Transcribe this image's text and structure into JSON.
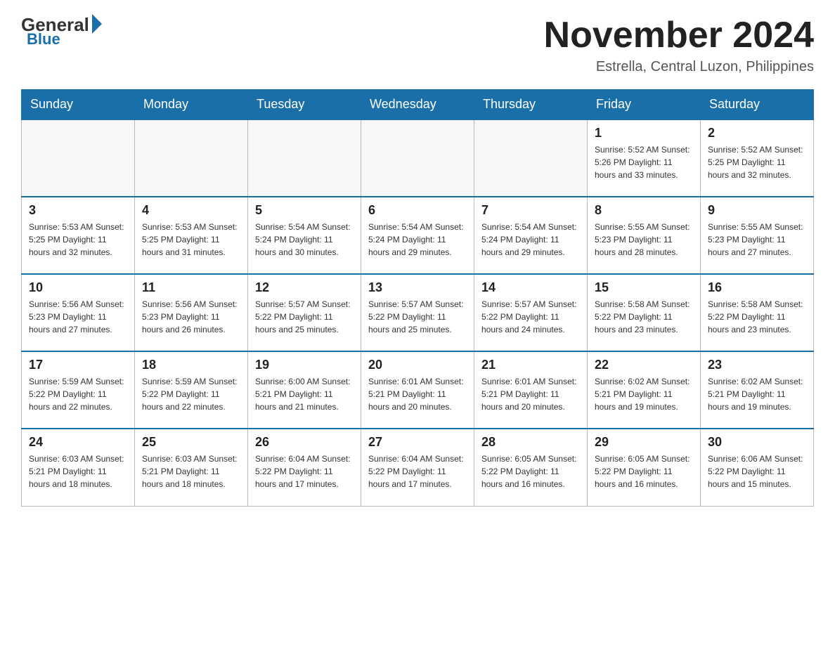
{
  "logo": {
    "general": "General",
    "blue": "Blue"
  },
  "title": "November 2024",
  "location": "Estrella, Central Luzon, Philippines",
  "days_of_week": [
    "Sunday",
    "Monday",
    "Tuesday",
    "Wednesday",
    "Thursday",
    "Friday",
    "Saturday"
  ],
  "weeks": [
    [
      {
        "day": "",
        "info": ""
      },
      {
        "day": "",
        "info": ""
      },
      {
        "day": "",
        "info": ""
      },
      {
        "day": "",
        "info": ""
      },
      {
        "day": "",
        "info": ""
      },
      {
        "day": "1",
        "info": "Sunrise: 5:52 AM\nSunset: 5:26 PM\nDaylight: 11 hours\nand 33 minutes."
      },
      {
        "day": "2",
        "info": "Sunrise: 5:52 AM\nSunset: 5:25 PM\nDaylight: 11 hours\nand 32 minutes."
      }
    ],
    [
      {
        "day": "3",
        "info": "Sunrise: 5:53 AM\nSunset: 5:25 PM\nDaylight: 11 hours\nand 32 minutes."
      },
      {
        "day": "4",
        "info": "Sunrise: 5:53 AM\nSunset: 5:25 PM\nDaylight: 11 hours\nand 31 minutes."
      },
      {
        "day": "5",
        "info": "Sunrise: 5:54 AM\nSunset: 5:24 PM\nDaylight: 11 hours\nand 30 minutes."
      },
      {
        "day": "6",
        "info": "Sunrise: 5:54 AM\nSunset: 5:24 PM\nDaylight: 11 hours\nand 29 minutes."
      },
      {
        "day": "7",
        "info": "Sunrise: 5:54 AM\nSunset: 5:24 PM\nDaylight: 11 hours\nand 29 minutes."
      },
      {
        "day": "8",
        "info": "Sunrise: 5:55 AM\nSunset: 5:23 PM\nDaylight: 11 hours\nand 28 minutes."
      },
      {
        "day": "9",
        "info": "Sunrise: 5:55 AM\nSunset: 5:23 PM\nDaylight: 11 hours\nand 27 minutes."
      }
    ],
    [
      {
        "day": "10",
        "info": "Sunrise: 5:56 AM\nSunset: 5:23 PM\nDaylight: 11 hours\nand 27 minutes."
      },
      {
        "day": "11",
        "info": "Sunrise: 5:56 AM\nSunset: 5:23 PM\nDaylight: 11 hours\nand 26 minutes."
      },
      {
        "day": "12",
        "info": "Sunrise: 5:57 AM\nSunset: 5:22 PM\nDaylight: 11 hours\nand 25 minutes."
      },
      {
        "day": "13",
        "info": "Sunrise: 5:57 AM\nSunset: 5:22 PM\nDaylight: 11 hours\nand 25 minutes."
      },
      {
        "day": "14",
        "info": "Sunrise: 5:57 AM\nSunset: 5:22 PM\nDaylight: 11 hours\nand 24 minutes."
      },
      {
        "day": "15",
        "info": "Sunrise: 5:58 AM\nSunset: 5:22 PM\nDaylight: 11 hours\nand 23 minutes."
      },
      {
        "day": "16",
        "info": "Sunrise: 5:58 AM\nSunset: 5:22 PM\nDaylight: 11 hours\nand 23 minutes."
      }
    ],
    [
      {
        "day": "17",
        "info": "Sunrise: 5:59 AM\nSunset: 5:22 PM\nDaylight: 11 hours\nand 22 minutes."
      },
      {
        "day": "18",
        "info": "Sunrise: 5:59 AM\nSunset: 5:22 PM\nDaylight: 11 hours\nand 22 minutes."
      },
      {
        "day": "19",
        "info": "Sunrise: 6:00 AM\nSunset: 5:21 PM\nDaylight: 11 hours\nand 21 minutes."
      },
      {
        "day": "20",
        "info": "Sunrise: 6:01 AM\nSunset: 5:21 PM\nDaylight: 11 hours\nand 20 minutes."
      },
      {
        "day": "21",
        "info": "Sunrise: 6:01 AM\nSunset: 5:21 PM\nDaylight: 11 hours\nand 20 minutes."
      },
      {
        "day": "22",
        "info": "Sunrise: 6:02 AM\nSunset: 5:21 PM\nDaylight: 11 hours\nand 19 minutes."
      },
      {
        "day": "23",
        "info": "Sunrise: 6:02 AM\nSunset: 5:21 PM\nDaylight: 11 hours\nand 19 minutes."
      }
    ],
    [
      {
        "day": "24",
        "info": "Sunrise: 6:03 AM\nSunset: 5:21 PM\nDaylight: 11 hours\nand 18 minutes."
      },
      {
        "day": "25",
        "info": "Sunrise: 6:03 AM\nSunset: 5:21 PM\nDaylight: 11 hours\nand 18 minutes."
      },
      {
        "day": "26",
        "info": "Sunrise: 6:04 AM\nSunset: 5:22 PM\nDaylight: 11 hours\nand 17 minutes."
      },
      {
        "day": "27",
        "info": "Sunrise: 6:04 AM\nSunset: 5:22 PM\nDaylight: 11 hours\nand 17 minutes."
      },
      {
        "day": "28",
        "info": "Sunrise: 6:05 AM\nSunset: 5:22 PM\nDaylight: 11 hours\nand 16 minutes."
      },
      {
        "day": "29",
        "info": "Sunrise: 6:05 AM\nSunset: 5:22 PM\nDaylight: 11 hours\nand 16 minutes."
      },
      {
        "day": "30",
        "info": "Sunrise: 6:06 AM\nSunset: 5:22 PM\nDaylight: 11 hours\nand 15 minutes."
      }
    ]
  ]
}
